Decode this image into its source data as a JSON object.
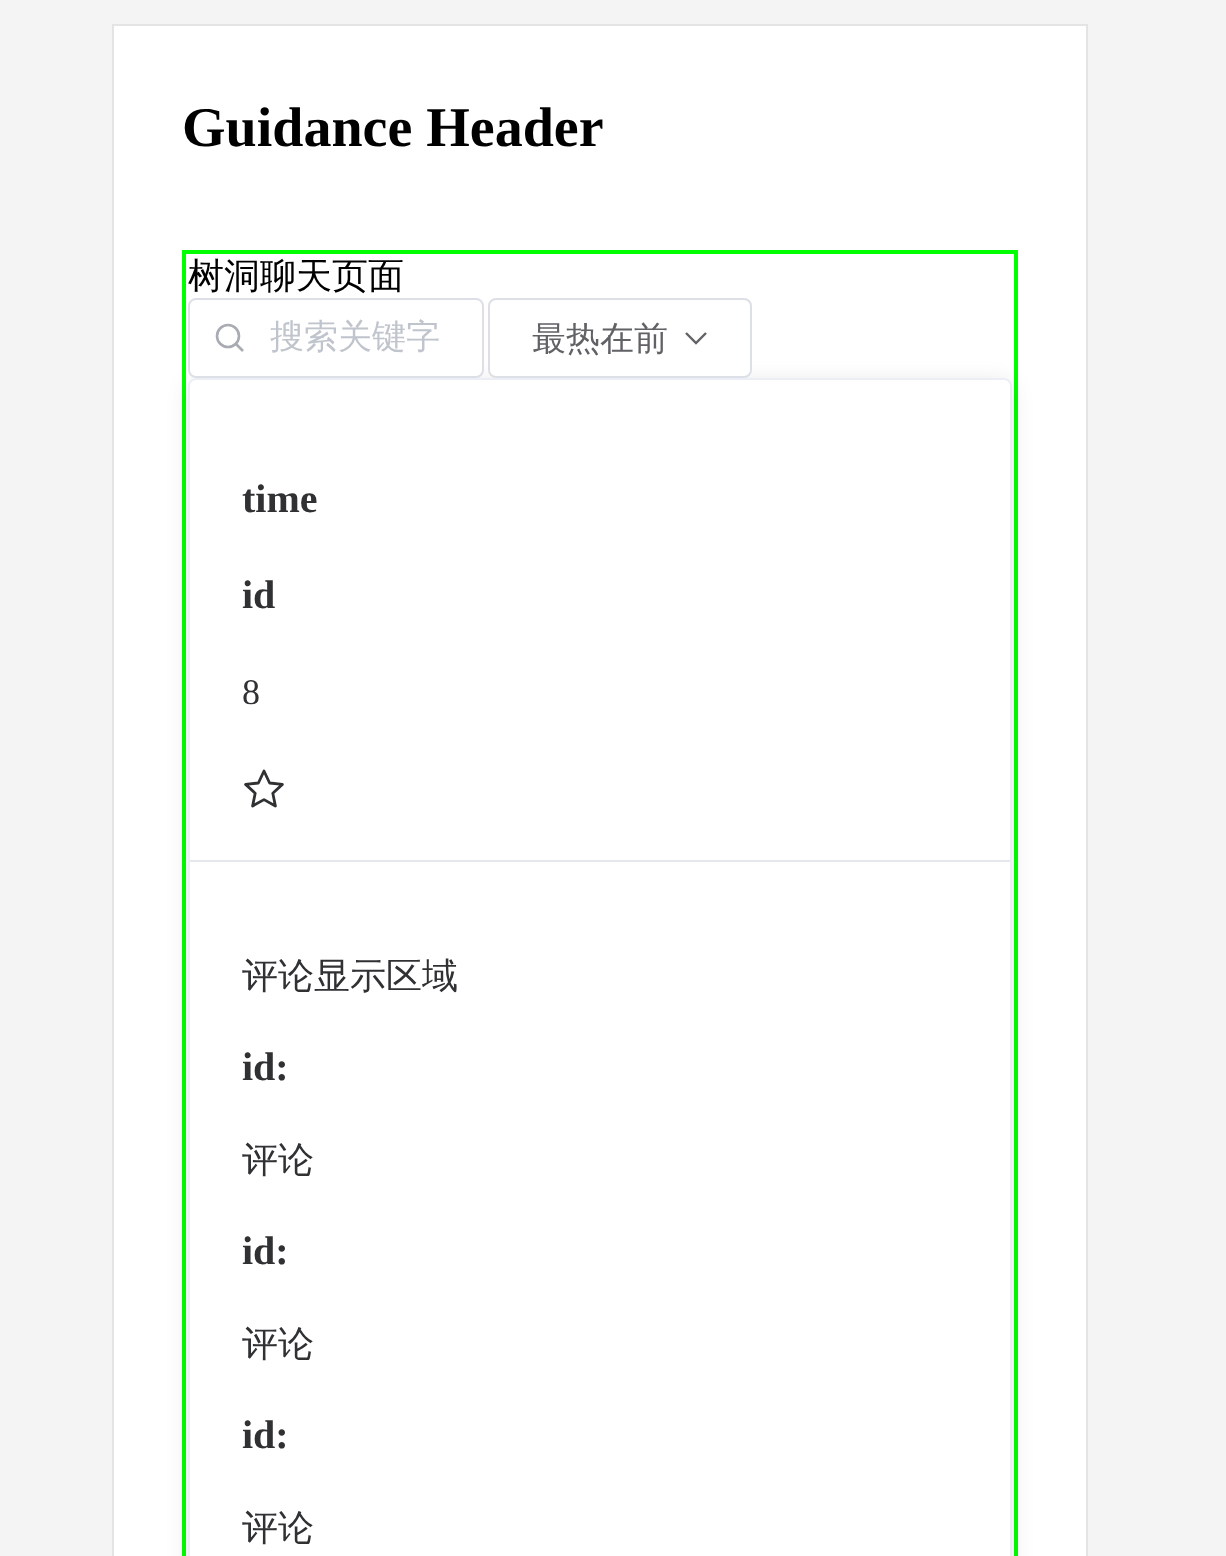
{
  "page_header": "Guidance Header",
  "title": "树洞聊天页面",
  "search": {
    "placeholder": "搜索关键字"
  },
  "sort": {
    "value": "最热在前"
  },
  "post": {
    "time": "time",
    "id": "id",
    "count": "8",
    "favorited": false
  },
  "comments": {
    "heading": "评论显示区域",
    "items": [
      {
        "id": "id:",
        "text": "评论"
      },
      {
        "id": "id:",
        "text": "评论"
      },
      {
        "id": "id:",
        "text": "评论"
      }
    ]
  }
}
